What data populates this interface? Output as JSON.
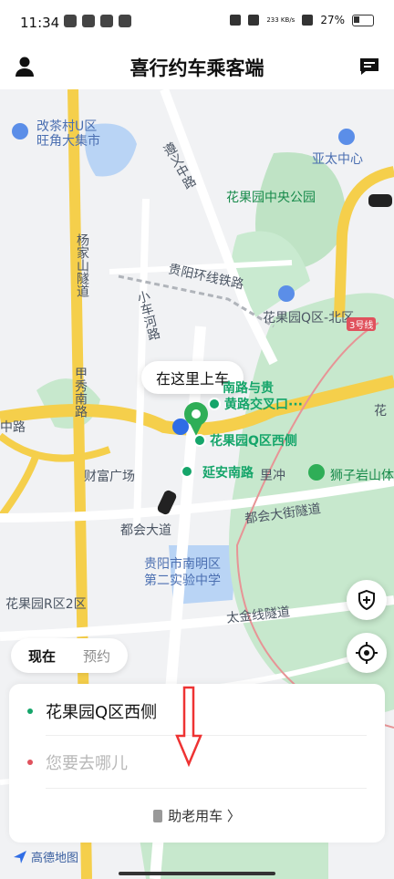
{
  "status": {
    "time": "11:34",
    "speed": "233 KB/s",
    "battery": "27%"
  },
  "header": {
    "title": "喜行约车乘客端",
    "profile_icon": "person-icon",
    "message_icon": "message-icon"
  },
  "map_labels": [
    {
      "text": "改茶村U区",
      "kind": "blue"
    },
    {
      "text": "旺角大集市",
      "kind": "blue"
    },
    {
      "text": "亚太中心",
      "kind": "blue"
    },
    {
      "text": "花果园中央公园",
      "kind": "green"
    },
    {
      "text": "遵义中路",
      "kind": ""
    },
    {
      "text": "杨家山隧道",
      "kind": ""
    },
    {
      "text": "贵阳环线铁路",
      "kind": ""
    },
    {
      "text": "小车河路",
      "kind": ""
    },
    {
      "text": "花果园Q区-北区",
      "kind": ""
    },
    {
      "text": "3号线",
      "kind": ""
    },
    {
      "text": "甲秀南路",
      "kind": ""
    },
    {
      "text": "中路",
      "kind": ""
    },
    {
      "text": "财富广场",
      "kind": ""
    },
    {
      "text": "都会大道",
      "kind": ""
    },
    {
      "text": "都会大街隧道",
      "kind": ""
    },
    {
      "text": "贵阳市南明区",
      "kind": "blue"
    },
    {
      "text": "第二实验中学",
      "kind": "blue"
    },
    {
      "text": "花果园R区2区",
      "kind": ""
    },
    {
      "text": "太金线隧道",
      "kind": ""
    },
    {
      "text": "狮子岩山体",
      "kind": "green"
    },
    {
      "text": "花",
      "kind": ""
    },
    {
      "text": "里冲",
      "kind": ""
    }
  ],
  "pickup": {
    "bubble": "在这里上车",
    "poi_1": "黄路交叉口···",
    "poi_1_top": "南路与贵",
    "poi_2": "花果园Q区西侧",
    "poi_3": "延安南路"
  },
  "mode": {
    "now": "现在",
    "reserve": "预约"
  },
  "trip": {
    "origin": "花果园Q区西侧",
    "destination_placeholder": "您要去哪儿",
    "elder_label": "助老用车 〉"
  },
  "attribution": "高德地图",
  "colors": {
    "green": "#15a56a",
    "red": "#e0525d",
    "accent": "#111111"
  }
}
